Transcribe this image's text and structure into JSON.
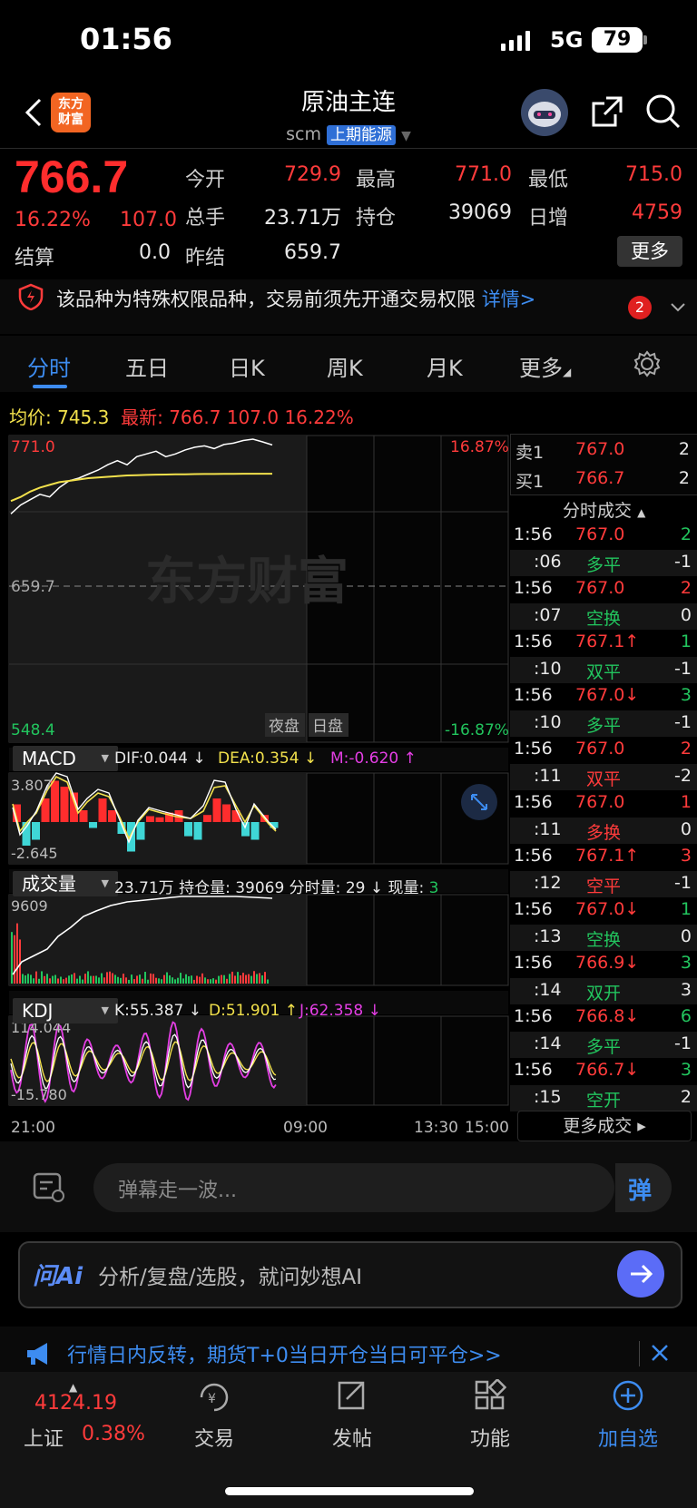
{
  "status": {
    "time": "01:56",
    "network": "5G",
    "battery": "79"
  },
  "header": {
    "logo_text_line1": "东方",
    "logo_text_line2": "财富",
    "title": "原油主连",
    "code": "scm",
    "exchange": "上期能源"
  },
  "quote": {
    "last_price": "766.7",
    "change_pct": "16.22%",
    "change": "107.0",
    "labels": {
      "open": "今开",
      "high": "最高",
      "low": "最低",
      "volume": "总手",
      "position": "持仓",
      "daily_increase": "日增",
      "settle": "结算",
      "prev_settle": "昨结"
    },
    "open": "729.9",
    "high": "771.0",
    "low": "715.0",
    "volume": "23.71万",
    "position": "39069",
    "daily_increase": "4759",
    "settle": "0.0",
    "prev_settle": "659.7",
    "more_label": "更多"
  },
  "notice": {
    "text": "该品种为特殊权限品种，交易前须先开通交易权限",
    "detail": "详情>",
    "badge": "2"
  },
  "tabs": [
    {
      "label": "分时",
      "active": true
    },
    {
      "label": "五日"
    },
    {
      "label": "日K"
    },
    {
      "label": "周K"
    },
    {
      "label": "月K"
    },
    {
      "label": "更多"
    }
  ],
  "chart_header": {
    "avg_label": "均价:",
    "avg_value": "745.3",
    "latest_label": "最新:",
    "latest_value": "766.7",
    "latest_change": "107.0",
    "latest_pct": "16.22%"
  },
  "chart_data": {
    "type": "line",
    "y_top_label": "771.0",
    "y_mid_label": "659.7",
    "y_bottom_label": "548.4",
    "pct_top": "16.87%",
    "pct_bottom": "-16.87%",
    "session_labels": [
      "夜盘",
      "日盘"
    ],
    "watermark": "东方财富",
    "x_ticks": [
      "21:00",
      "09:00",
      "13:30",
      "15:00"
    ],
    "price_series": [
      715.5,
      722,
      726,
      730,
      728,
      735,
      740,
      742,
      745,
      748,
      752,
      755,
      752,
      758,
      760,
      762,
      758,
      760,
      763,
      765,
      766,
      764,
      767,
      768,
      770,
      771,
      769,
      766.7
    ],
    "avg_series": [
      725,
      728,
      732,
      735,
      737,
      739,
      740,
      741,
      742,
      742.5,
      743,
      743.5,
      744,
      744.2,
      744.4,
      744.6,
      744.7,
      744.8,
      744.9,
      745,
      745.1,
      745.1,
      745.2,
      745.2,
      745.3,
      745.3,
      745.3,
      745.3
    ],
    "ylim": [
      548.4,
      771.0
    ]
  },
  "macd": {
    "name": "MACD",
    "dif": "DIF:0.044 ↓",
    "dea": "DEA:0.354 ↓",
    "m": "M:-0.620 ↑",
    "top": "3.807",
    "bottom": "-2.645",
    "hist": [
      1.5,
      -2,
      -1.5,
      2,
      3.5,
      3,
      2.5,
      1,
      -0.5,
      2,
      1,
      -1,
      -2.5,
      -1.5,
      0.5,
      0.4,
      0.8,
      1,
      -1.2,
      -1.5,
      0.6,
      2,
      1.5,
      1,
      -1.2,
      -1.5,
      0.6,
      -0.5
    ]
  },
  "volume": {
    "name": "成交量",
    "info": "23.71万 持仓量: 39069 分时量: 29 ↓ 现量: ",
    "current": "3",
    "top": "9609"
  },
  "kdj": {
    "name": "KDJ",
    "k": "K:55.387 ↓",
    "d": "D:51.901 ↑",
    "j": "J:62.358 ↓",
    "top": "114.044",
    "bottom": "-15.780"
  },
  "orderbook": {
    "sell_label": "卖1",
    "sell_price": "767.0",
    "sell_qty": "2",
    "buy_label": "买1",
    "buy_price": "766.7",
    "buy_qty": "2",
    "trades_title": "分时成交"
  },
  "trades": [
    {
      "time": "1:56",
      "price": "767.0",
      "qty": "2",
      "pc": "red",
      "qc": "green"
    },
    {
      "time": ":06",
      "price": "多平",
      "qty": "-1",
      "pc": "green",
      "qc": "white"
    },
    {
      "time": "1:56",
      "price": "767.0",
      "qty": "2",
      "pc": "red",
      "qc": "red"
    },
    {
      "time": ":07",
      "price": "空换",
      "qty": "0",
      "pc": "green",
      "qc": "white"
    },
    {
      "time": "1:56",
      "price": "767.1↑",
      "qty": "1",
      "pc": "red",
      "qc": "green"
    },
    {
      "time": ":10",
      "price": "双平",
      "qty": "-1",
      "pc": "green",
      "qc": "white"
    },
    {
      "time": "1:56",
      "price": "767.0↓",
      "qty": "3",
      "pc": "red",
      "qc": "green"
    },
    {
      "time": ":10",
      "price": "多平",
      "qty": "-1",
      "pc": "green",
      "qc": "white"
    },
    {
      "time": "1:56",
      "price": "767.0",
      "qty": "2",
      "pc": "red",
      "qc": "red"
    },
    {
      "time": ":11",
      "price": "双平",
      "qty": "-2",
      "pc": "red",
      "qc": "white"
    },
    {
      "time": "1:56",
      "price": "767.0",
      "qty": "1",
      "pc": "red",
      "qc": "red"
    },
    {
      "time": ":11",
      "price": "多换",
      "qty": "0",
      "pc": "red",
      "qc": "white"
    },
    {
      "time": "1:56",
      "price": "767.1↑",
      "qty": "3",
      "pc": "red",
      "qc": "red"
    },
    {
      "time": ":12",
      "price": "空平",
      "qty": "-1",
      "pc": "red",
      "qc": "white"
    },
    {
      "time": "1:56",
      "price": "767.0↓",
      "qty": "1",
      "pc": "red",
      "qc": "green"
    },
    {
      "time": ":13",
      "price": "空换",
      "qty": "0",
      "pc": "green",
      "qc": "white"
    },
    {
      "time": "1:56",
      "price": "766.9↓",
      "qty": "3",
      "pc": "red",
      "qc": "green"
    },
    {
      "time": ":14",
      "price": "双开",
      "qty": "3",
      "pc": "green",
      "qc": "white"
    },
    {
      "time": "1:56",
      "price": "766.8↓",
      "qty": "6",
      "pc": "red",
      "qc": "green"
    },
    {
      "time": ":14",
      "price": "多平",
      "qty": "-1",
      "pc": "green",
      "qc": "white"
    },
    {
      "time": "1:56",
      "price": "766.7↓",
      "qty": "3",
      "pc": "red",
      "qc": "green"
    },
    {
      "time": ":15",
      "price": "空开",
      "qty": "2",
      "pc": "green",
      "qc": "white"
    }
  ],
  "more_trades": "更多成交 ▸",
  "comment": {
    "placeholder": "弹幕走一波...",
    "danmu": "弹"
  },
  "ai": {
    "logo": "问Ai",
    "placeholder": "分析/复盘/选股，就问妙想AI"
  },
  "promo": {
    "text": "行情日内反转，期货T+0当日开仓当日可平仓>>"
  },
  "bottom_nav": {
    "index_value": "4124.19",
    "index_name": "上证",
    "index_pct": "0.38%",
    "trade": "交易",
    "post": "发帖",
    "function": "功能",
    "add_watch": "加自选"
  }
}
